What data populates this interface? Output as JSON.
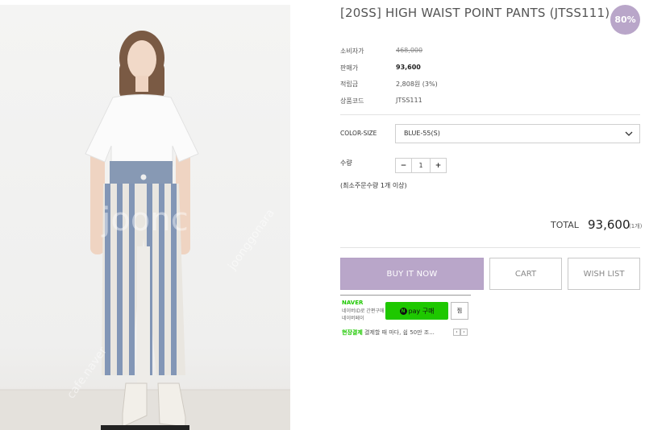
{
  "product": {
    "title": "[20SS] HIGH WAIST POINT PANTS (JTSS111)",
    "discount_badge": "80%"
  },
  "info": [
    {
      "label": "소비자가",
      "value": "468,000"
    },
    {
      "label": "판매가",
      "value": "93,600"
    },
    {
      "label": "적립금",
      "value": "2,808원 (3%)"
    },
    {
      "label": "상품코드",
      "value": "JTSS111"
    }
  ],
  "option": {
    "label": "COLOR-SIZE",
    "selected": "BLUE-55(S)"
  },
  "quantity": {
    "label": "수량",
    "minus": "−",
    "value": "1",
    "plus": "+",
    "min_note": "(최소주문수량 1개 이상)"
  },
  "total": {
    "label": "TOTAL",
    "value": "93,600",
    "count": "(1개)"
  },
  "buttons": {
    "buy": "BUY IT NOW",
    "cart": "CART",
    "wish": "WISH LIST"
  },
  "npay": {
    "brand": "NAVER",
    "sub1": "네이버ID로 간편구매",
    "sub2": "네이버페이",
    "button": "pay 구매",
    "n_mark": "N",
    "zzim": "찜",
    "promo_label": "현장결제",
    "promo_text": "결제할 때 마다, 쉽 50만 조...",
    "prev": "‹",
    "next": "›"
  },
  "colors": {
    "accent": "#b9a6c9",
    "naver_green": "#1ec800"
  }
}
